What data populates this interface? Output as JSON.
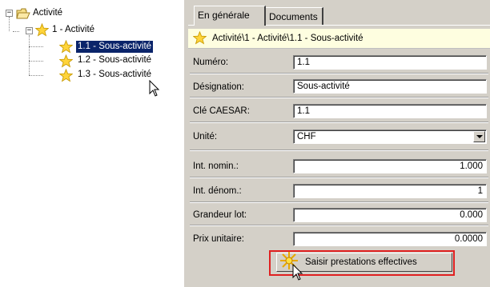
{
  "tree": {
    "root": {
      "label": "Activité",
      "expander": "−",
      "icon": "folder-icon"
    },
    "level1": {
      "label": "1 - Activité",
      "expander": "−",
      "icon": "star-icon"
    },
    "children": [
      {
        "label": "1.1 - Sous-activité",
        "selected": true,
        "icon": "star-icon"
      },
      {
        "label": "1.2 - Sous-activité",
        "selected": false,
        "icon": "star-icon"
      },
      {
        "label": "1.3 - Sous-activité",
        "selected": false,
        "icon": "star-icon"
      }
    ]
  },
  "tabs": [
    {
      "label": "En générale",
      "active": true
    },
    {
      "label": "Documents",
      "active": false
    }
  ],
  "breadcrumb": {
    "icon": "star-icon",
    "text": "Activité\\1 - Activité\\1.1 - Sous-activité"
  },
  "form": {
    "numero": {
      "label": "Numéro:",
      "value": "1.1"
    },
    "designation": {
      "label": "Désignation:",
      "value": "Sous-activité"
    },
    "cle_caesar": {
      "label": "Clé CAESAR:",
      "value": "1.1"
    },
    "unite": {
      "label": "Unité:",
      "value": "CHF"
    },
    "int_nomin": {
      "label": "Int. nomin.:",
      "value": "1.000"
    },
    "int_denom": {
      "label": "Int. dénom.:",
      "value": "1"
    },
    "grandeur_lot": {
      "label": "Grandeur lot:",
      "value": "0.000"
    },
    "prix_unitaire": {
      "label": "Prix unitaire:",
      "value": "0.0000"
    }
  },
  "action": {
    "label": "Saisir prestations effectives",
    "icon": "sparkle-icon"
  },
  "colors": {
    "selection": "#0a246a",
    "highlight": "#e02020",
    "breadcrumb_bg": "#fefee0",
    "panel_bg": "#d4d0c8"
  }
}
